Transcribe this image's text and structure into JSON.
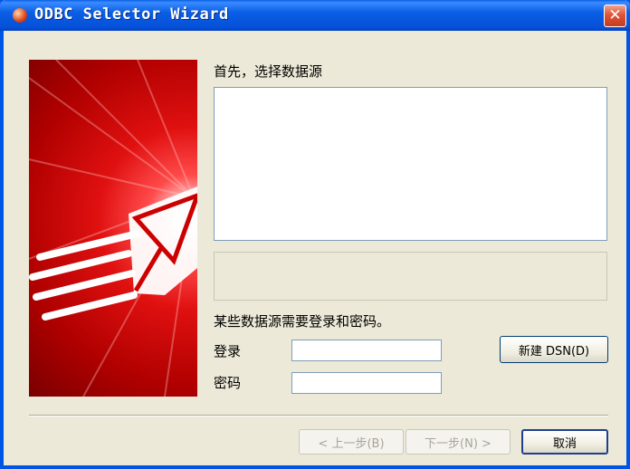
{
  "window": {
    "title": "ODBC Selector Wizard",
    "close": "✕"
  },
  "main": {
    "heading": "首先，选择数据源",
    "login_prompt": "某些数据源需要登录和密码。",
    "login_label": "登录",
    "password_label": "密码",
    "login_value": "",
    "password_value": ""
  },
  "buttons": {
    "new_dsn": "新建 DSN(D)",
    "back": "< 上一步(B)",
    "next": "下一步(N) >",
    "cancel": "取消"
  },
  "colors": {
    "titlebar": "#0a5fe5",
    "banner": "#d00000",
    "dialog_bg": "#ece9d8"
  }
}
